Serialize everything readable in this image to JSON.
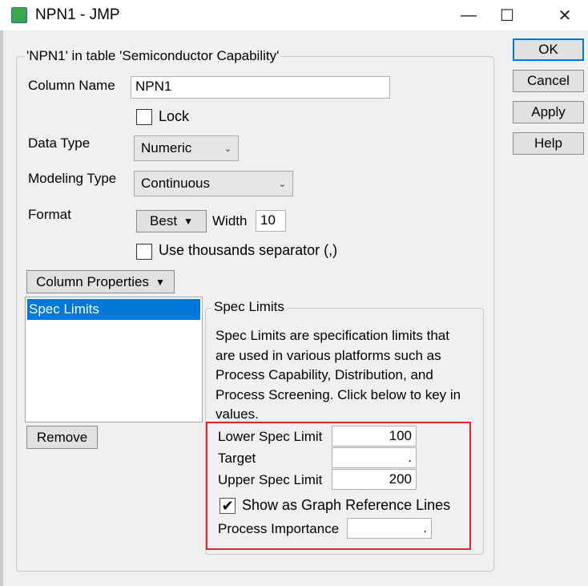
{
  "window": {
    "title": "NPN1 - JMP",
    "icon": "jmp-table-icon"
  },
  "group_title": "'NPN1' in table 'Semiconductor Capability'",
  "column_name": {
    "label": "Column Name",
    "value": "NPN1"
  },
  "lock": {
    "label": "Lock",
    "checked": false
  },
  "data_type": {
    "label": "Data Type",
    "value": "Numeric"
  },
  "modeling_type": {
    "label": "Modeling Type",
    "value": "Continuous"
  },
  "format": {
    "label": "Format",
    "value": "Best",
    "width_label": "Width",
    "width_value": "10"
  },
  "thousands": {
    "label": "Use thousands separator (,)",
    "checked": false
  },
  "column_properties": {
    "label": "Column Properties",
    "items": [
      "Spec Limits"
    ],
    "remove_label": "Remove"
  },
  "spec_limits": {
    "title": "Spec Limits",
    "description": "Spec Limits are specification limits that are used in various platforms such as Process Capability, Distribution, and Process Screening. Click below to key in values.",
    "lsl_label": "Lower Spec Limit",
    "lsl": "100",
    "target_label": "Target",
    "target": ".",
    "usl_label": "Upper Spec Limit",
    "usl": "200",
    "show_lines_label": "Show as Graph Reference Lines",
    "show_lines": true,
    "importance_label": "Process Importance",
    "importance": ".",
    "highlight_color": "#e8202a"
  },
  "buttons": {
    "ok": "OK",
    "cancel": "Cancel",
    "apply": "Apply",
    "help": "Help"
  }
}
